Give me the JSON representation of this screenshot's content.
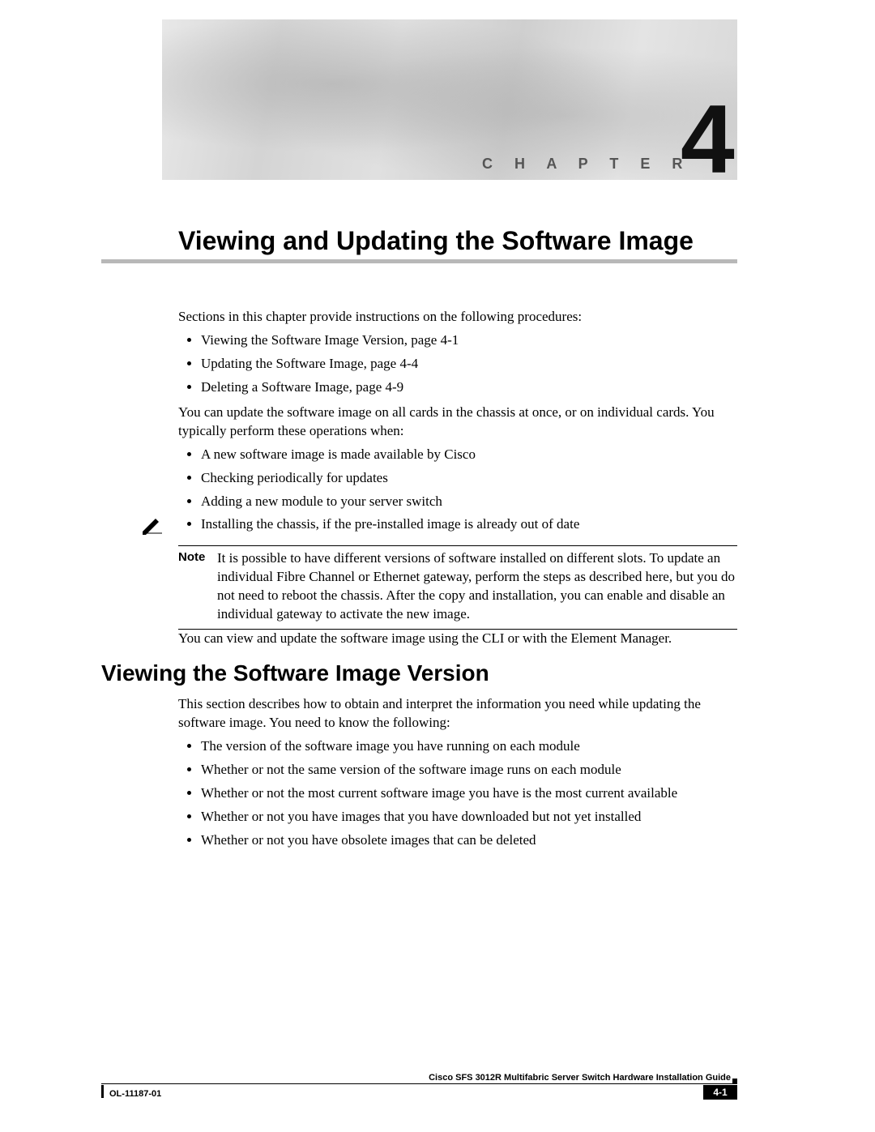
{
  "chapter": {
    "label": "C H A P T E R",
    "number": "4",
    "title": "Viewing and Updating the Software Image"
  },
  "intro": {
    "lead": "Sections in this chapter provide instructions on the following procedures:",
    "toc": [
      "Viewing the Software Image Version, page 4-1",
      "Updating the Software Image, page 4-4",
      "Deleting a Software Image, page 4-9"
    ],
    "para2": "You can update the software image on all cards in the chassis at once, or on individual cards. You typically perform these operations when:",
    "when_list": [
      "A new software image is made available by Cisco",
      "Checking periodically for updates",
      "Adding a new module to your server switch",
      "Installing the chassis, if the pre-installed image is already out of date"
    ]
  },
  "note": {
    "label": "Note",
    "text": "It is possible to have different versions of software installed on different slots. To update an individual Fibre Channel or Ethernet gateway, perform the steps as described here, but you do not need to reboot the chassis. After the copy and installation, you can enable and disable an individual gateway to activate the new image."
  },
  "after_note": "You can view and update the software image using the CLI or with the Element Manager.",
  "section": {
    "heading": "Viewing the Software Image Version",
    "para": "This section describes how to obtain and interpret the information you need while updating the software image. You need to know the following:",
    "items": [
      "The version of the software image you have running on each module",
      "Whether or not the same version of the software image runs on each module",
      "Whether or not the most current software image you have is the most current available",
      "Whether or not you have images that you have downloaded but not yet installed",
      "Whether or not you have obsolete images that can be deleted"
    ]
  },
  "footer": {
    "guide": "Cisco SFS 3012R Multifabric Server Switch Hardware Installation Guide",
    "doc_id": "OL-11187-01",
    "page": "4-1"
  }
}
